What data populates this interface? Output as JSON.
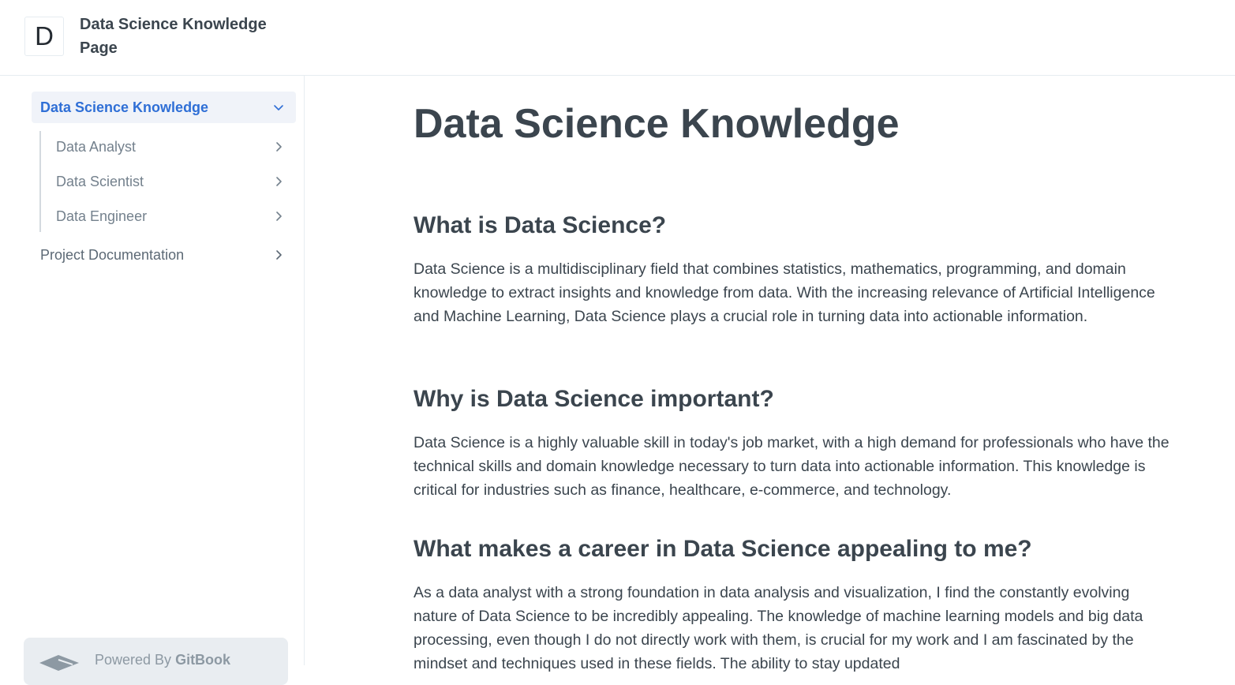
{
  "header": {
    "logo_letter": "D",
    "site_title": "Data Science Knowledge Page"
  },
  "sidebar": {
    "active_item": {
      "label": "Data Science Knowledge",
      "icon": "chevron-down-icon"
    },
    "sub_items": [
      {
        "label": "Data Analyst",
        "icon": "chevron-right-icon"
      },
      {
        "label": "Data Scientist",
        "icon": "chevron-right-icon"
      },
      {
        "label": "Data Engineer",
        "icon": "chevron-right-icon"
      }
    ],
    "top_items": [
      {
        "label": "Project Documentation",
        "icon": "chevron-right-icon"
      }
    ],
    "powered_by": {
      "prefix": "Powered By",
      "brand": "GitBook"
    }
  },
  "main": {
    "title": "Data Science Knowledge",
    "sections": [
      {
        "heading": "What is Data Science?",
        "body": "Data Science is a multidisciplinary field that combines statistics, mathematics, programming, and domain knowledge to extract insights and knowledge from data. With the increasing relevance of Artificial Intelligence and Machine Learning, Data Science plays a crucial role in turning data into actionable information."
      },
      {
        "heading": "Why is Data Science important?",
        "body": "Data Science is a highly valuable skill in today's job market, with a high demand for professionals who have the technical skills and domain knowledge necessary to turn data into actionable information. This knowledge is critical for industries such as finance, healthcare, e-commerce, and technology."
      },
      {
        "heading": "What makes a career in Data Science appealing to me?",
        "body": "As a data analyst with a strong foundation in data analysis and visualization, I find the constantly evolving nature of Data Science to be incredibly appealing. The knowledge of machine learning models and big data processing, even though I do not directly work with them, is crucial for my work and I am fascinated by the mindset and techniques used in these fields. The ability to stay updated"
      }
    ]
  },
  "colors": {
    "accent": "#2f6fd6",
    "text": "#3b454e",
    "muted": "#74818d",
    "active_bg": "#f0f3f9",
    "border": "#e6ecf1"
  }
}
